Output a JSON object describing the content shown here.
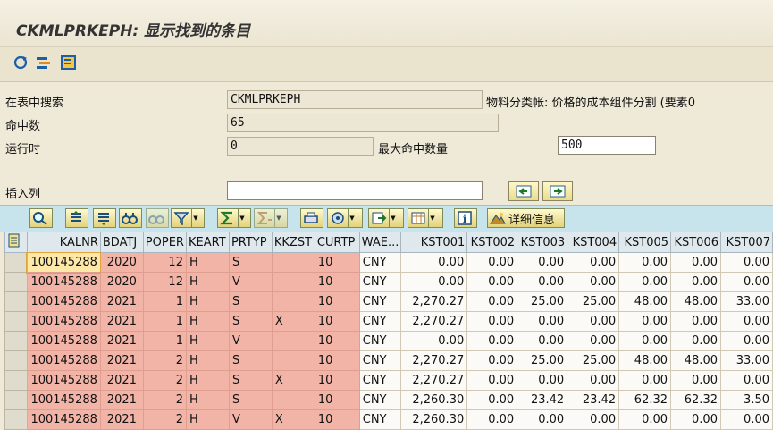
{
  "window": {
    "title": "CKMLPRKEPH: 显示找到的条目"
  },
  "form": {
    "search_label": "在表中搜索",
    "search_value": "CKMLPRKEPH",
    "table_desc": "物料分类帐: 价格的成本组件分割 (要素0",
    "hits_label": "命中数",
    "hits_value": "65",
    "runtime_label": "运行时",
    "runtime_value": "0",
    "maxhits_label": "最大命中数量",
    "maxhits_value": "500",
    "insert_col_label": "插入列",
    "insert_col_value": ""
  },
  "toolbar": {
    "details_label": "详细信息"
  },
  "grid": {
    "columns": [
      "KALNR",
      "BDATJ",
      "POPER",
      "KEART",
      "PRTYP",
      "KKZST",
      "CURTP",
      "WAE...",
      "KST001",
      "KST002",
      "KST003",
      "KST004",
      "KST005",
      "KST006",
      "KST007"
    ],
    "rows": [
      [
        "100145288",
        "2020",
        "12",
        "H",
        "S",
        "",
        "10",
        "CNY",
        "0.00",
        "0.00",
        "0.00",
        "0.00",
        "0.00",
        "0.00",
        "0.00"
      ],
      [
        "100145288",
        "2020",
        "12",
        "H",
        "V",
        "",
        "10",
        "CNY",
        "0.00",
        "0.00",
        "0.00",
        "0.00",
        "0.00",
        "0.00",
        "0.00"
      ],
      [
        "100145288",
        "2021",
        "1",
        "H",
        "S",
        "",
        "10",
        "CNY",
        "2,270.27",
        "0.00",
        "25.00",
        "25.00",
        "48.00",
        "48.00",
        "33.00"
      ],
      [
        "100145288",
        "2021",
        "1",
        "H",
        "S",
        "X",
        "10",
        "CNY",
        "2,270.27",
        "0.00",
        "0.00",
        "0.00",
        "0.00",
        "0.00",
        "0.00"
      ],
      [
        "100145288",
        "2021",
        "1",
        "H",
        "V",
        "",
        "10",
        "CNY",
        "0.00",
        "0.00",
        "0.00",
        "0.00",
        "0.00",
        "0.00",
        "0.00"
      ],
      [
        "100145288",
        "2021",
        "2",
        "H",
        "S",
        "",
        "10",
        "CNY",
        "2,270.27",
        "0.00",
        "25.00",
        "25.00",
        "48.00",
        "48.00",
        "33.00"
      ],
      [
        "100145288",
        "2021",
        "2",
        "H",
        "S",
        "X",
        "10",
        "CNY",
        "2,270.27",
        "0.00",
        "0.00",
        "0.00",
        "0.00",
        "0.00",
        "0.00"
      ],
      [
        "100145288",
        "2021",
        "2",
        "H",
        "S",
        "",
        "10",
        "CNY",
        "2,260.30",
        "0.00",
        "23.42",
        "23.42",
        "62.32",
        "62.32",
        "3.50"
      ],
      [
        "100145288",
        "2021",
        "2",
        "H",
        "V",
        "X",
        "10",
        "CNY",
        "2,260.30",
        "0.00",
        "0.00",
        "0.00",
        "0.00",
        "0.00",
        "0.00"
      ]
    ]
  }
}
